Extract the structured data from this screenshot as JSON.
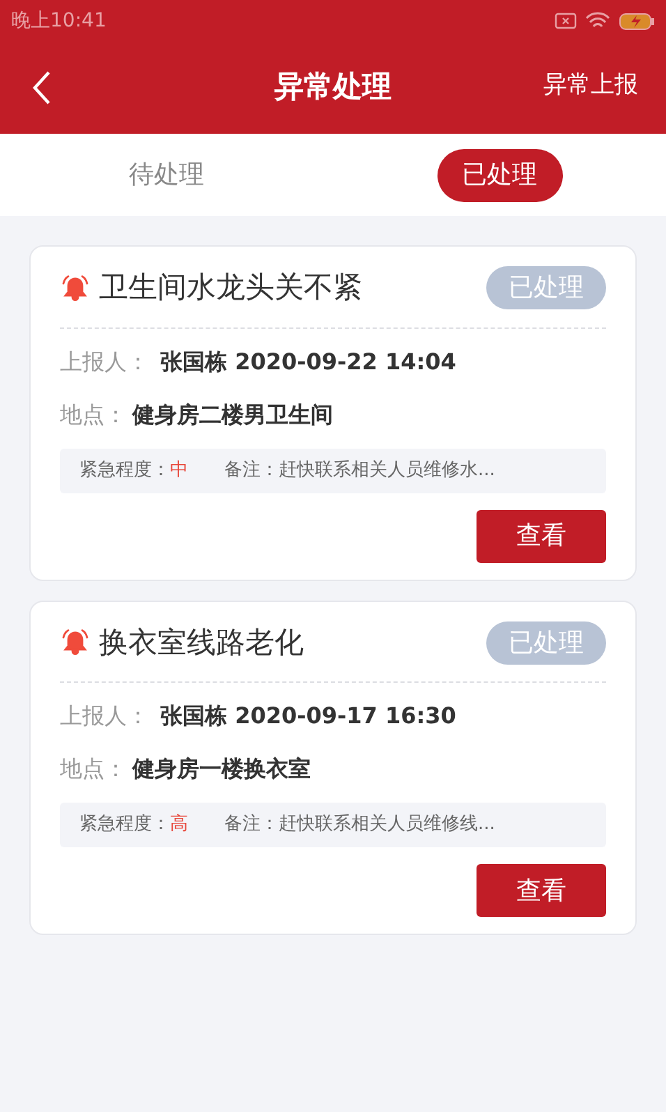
{
  "status_bar": {
    "time": "晚上10:41"
  },
  "header": {
    "title": "异常处理",
    "action": "异常上报"
  },
  "tabs": [
    {
      "label": "待处理",
      "selected": false
    },
    {
      "label": "已处理",
      "selected": true
    }
  ],
  "cards": [
    {
      "title": "卫生间水龙头关不紧",
      "status": "已处理",
      "reporter_label": "上报人：",
      "reporter": "张国栋 2020-09-22 14:04",
      "location_label": "地点：",
      "location": "健身房二楼男卫生间",
      "urgency_label": "紧急程度：",
      "urgency": "中",
      "note_label": "备注：",
      "note": "赶快联系相关人员维修水...",
      "button": "查看"
    },
    {
      "title": "换衣室线路老化",
      "status": "已处理",
      "reporter_label": "上报人：",
      "reporter": "张国栋 2020-09-17 16:30",
      "location_label": "地点：",
      "location": "健身房一楼换衣室",
      "urgency_label": "紧急程度：",
      "urgency": "高",
      "note_label": "备注：",
      "note": "赶快联系相关人员维修线...",
      "button": "查看"
    }
  ]
}
